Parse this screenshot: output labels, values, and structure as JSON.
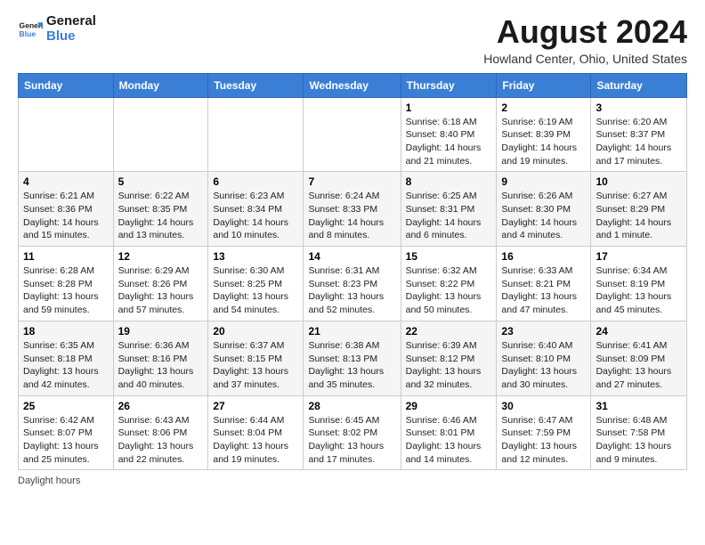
{
  "header": {
    "logo_line1": "General",
    "logo_line2": "Blue",
    "month": "August 2024",
    "location": "Howland Center, Ohio, United States"
  },
  "days_of_week": [
    "Sunday",
    "Monday",
    "Tuesday",
    "Wednesday",
    "Thursday",
    "Friday",
    "Saturday"
  ],
  "weeks": [
    [
      {
        "num": "",
        "info": ""
      },
      {
        "num": "",
        "info": ""
      },
      {
        "num": "",
        "info": ""
      },
      {
        "num": "",
        "info": ""
      },
      {
        "num": "1",
        "info": "Sunrise: 6:18 AM\nSunset: 8:40 PM\nDaylight: 14 hours and 21 minutes."
      },
      {
        "num": "2",
        "info": "Sunrise: 6:19 AM\nSunset: 8:39 PM\nDaylight: 14 hours and 19 minutes."
      },
      {
        "num": "3",
        "info": "Sunrise: 6:20 AM\nSunset: 8:37 PM\nDaylight: 14 hours and 17 minutes."
      }
    ],
    [
      {
        "num": "4",
        "info": "Sunrise: 6:21 AM\nSunset: 8:36 PM\nDaylight: 14 hours and 15 minutes."
      },
      {
        "num": "5",
        "info": "Sunrise: 6:22 AM\nSunset: 8:35 PM\nDaylight: 14 hours and 13 minutes."
      },
      {
        "num": "6",
        "info": "Sunrise: 6:23 AM\nSunset: 8:34 PM\nDaylight: 14 hours and 10 minutes."
      },
      {
        "num": "7",
        "info": "Sunrise: 6:24 AM\nSunset: 8:33 PM\nDaylight: 14 hours and 8 minutes."
      },
      {
        "num": "8",
        "info": "Sunrise: 6:25 AM\nSunset: 8:31 PM\nDaylight: 14 hours and 6 minutes."
      },
      {
        "num": "9",
        "info": "Sunrise: 6:26 AM\nSunset: 8:30 PM\nDaylight: 14 hours and 4 minutes."
      },
      {
        "num": "10",
        "info": "Sunrise: 6:27 AM\nSunset: 8:29 PM\nDaylight: 14 hours and 1 minute."
      }
    ],
    [
      {
        "num": "11",
        "info": "Sunrise: 6:28 AM\nSunset: 8:28 PM\nDaylight: 13 hours and 59 minutes."
      },
      {
        "num": "12",
        "info": "Sunrise: 6:29 AM\nSunset: 8:26 PM\nDaylight: 13 hours and 57 minutes."
      },
      {
        "num": "13",
        "info": "Sunrise: 6:30 AM\nSunset: 8:25 PM\nDaylight: 13 hours and 54 minutes."
      },
      {
        "num": "14",
        "info": "Sunrise: 6:31 AM\nSunset: 8:23 PM\nDaylight: 13 hours and 52 minutes."
      },
      {
        "num": "15",
        "info": "Sunrise: 6:32 AM\nSunset: 8:22 PM\nDaylight: 13 hours and 50 minutes."
      },
      {
        "num": "16",
        "info": "Sunrise: 6:33 AM\nSunset: 8:21 PM\nDaylight: 13 hours and 47 minutes."
      },
      {
        "num": "17",
        "info": "Sunrise: 6:34 AM\nSunset: 8:19 PM\nDaylight: 13 hours and 45 minutes."
      }
    ],
    [
      {
        "num": "18",
        "info": "Sunrise: 6:35 AM\nSunset: 8:18 PM\nDaylight: 13 hours and 42 minutes."
      },
      {
        "num": "19",
        "info": "Sunrise: 6:36 AM\nSunset: 8:16 PM\nDaylight: 13 hours and 40 minutes."
      },
      {
        "num": "20",
        "info": "Sunrise: 6:37 AM\nSunset: 8:15 PM\nDaylight: 13 hours and 37 minutes."
      },
      {
        "num": "21",
        "info": "Sunrise: 6:38 AM\nSunset: 8:13 PM\nDaylight: 13 hours and 35 minutes."
      },
      {
        "num": "22",
        "info": "Sunrise: 6:39 AM\nSunset: 8:12 PM\nDaylight: 13 hours and 32 minutes."
      },
      {
        "num": "23",
        "info": "Sunrise: 6:40 AM\nSunset: 8:10 PM\nDaylight: 13 hours and 30 minutes."
      },
      {
        "num": "24",
        "info": "Sunrise: 6:41 AM\nSunset: 8:09 PM\nDaylight: 13 hours and 27 minutes."
      }
    ],
    [
      {
        "num": "25",
        "info": "Sunrise: 6:42 AM\nSunset: 8:07 PM\nDaylight: 13 hours and 25 minutes."
      },
      {
        "num": "26",
        "info": "Sunrise: 6:43 AM\nSunset: 8:06 PM\nDaylight: 13 hours and 22 minutes."
      },
      {
        "num": "27",
        "info": "Sunrise: 6:44 AM\nSunset: 8:04 PM\nDaylight: 13 hours and 19 minutes."
      },
      {
        "num": "28",
        "info": "Sunrise: 6:45 AM\nSunset: 8:02 PM\nDaylight: 13 hours and 17 minutes."
      },
      {
        "num": "29",
        "info": "Sunrise: 6:46 AM\nSunset: 8:01 PM\nDaylight: 13 hours and 14 minutes."
      },
      {
        "num": "30",
        "info": "Sunrise: 6:47 AM\nSunset: 7:59 PM\nDaylight: 13 hours and 12 minutes."
      },
      {
        "num": "31",
        "info": "Sunrise: 6:48 AM\nSunset: 7:58 PM\nDaylight: 13 hours and 9 minutes."
      }
    ]
  ],
  "footer": "Daylight hours"
}
